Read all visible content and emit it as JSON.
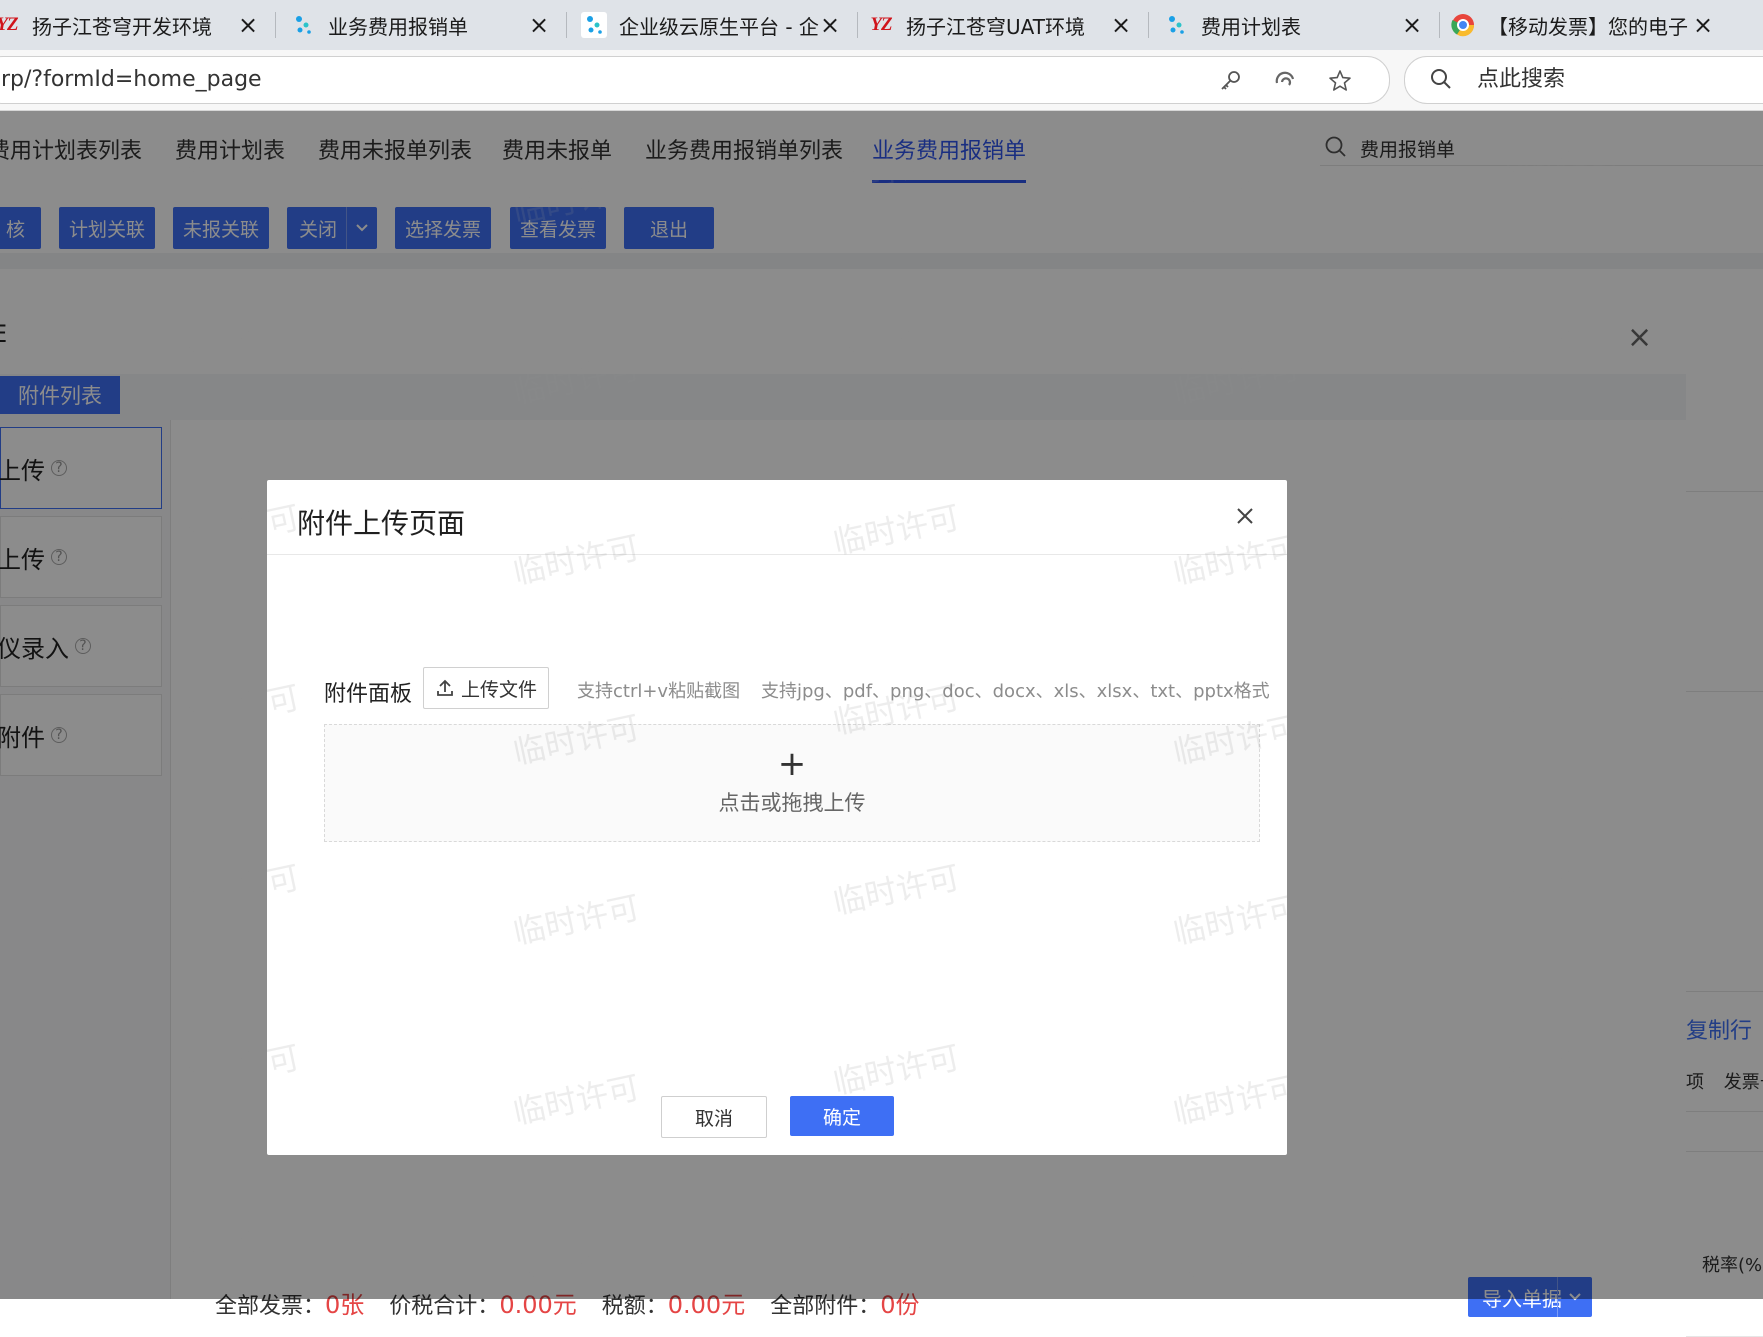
{
  "browser": {
    "tabs": [
      {
        "label": "扬子江苍穹开发环境",
        "icon": "yz-logo-icon"
      },
      {
        "label": "业务费用报销单",
        "icon": "cloud-dots-icon"
      },
      {
        "label": "企业级云原生平台 - 企业",
        "icon": "cloud-dots-icon"
      },
      {
        "label": "扬子江苍穹UAT环境",
        "icon": "yz-logo-icon"
      },
      {
        "label": "费用计划表",
        "icon": "cloud-dots-icon"
      },
      {
        "label": "【移动发票】您的电子发",
        "icon": "chrome-like-icon"
      }
    ],
    "url": "rp/?formId=home_page",
    "search_placeholder": "点此搜索"
  },
  "app": {
    "nav_tabs": [
      "费用计划表列表",
      "费用计划表",
      "费用未报单列表",
      "费用未报单",
      "业务费用报销单列表",
      "业务费用报销单"
    ],
    "active_tab": "业务费用报销单",
    "search_text": "费用报销单",
    "toolbar": [
      "核",
      "计划关联",
      "未报关联",
      "关闭",
      "选择发票",
      "查看发票",
      "退出"
    ],
    "right_panel": {
      "copy_row": "复制行",
      "invoice_no": "发票号",
      "invoice_prefix": "项",
      "tax_rate": "税率(%)"
    }
  },
  "attach_window": {
    "title": "E",
    "tab": "附件列表",
    "side_items": [
      "上传",
      "上传",
      "仪录入",
      "附件"
    ],
    "summary": {
      "all_invoice_label": "全部发票：",
      "all_invoice_value": "0张",
      "total_label": "价税合计：",
      "total_value": "0.00元",
      "tax_label": "税额：",
      "tax_value": "0.00元",
      "attach_label": "全部附件：",
      "attach_value": "0份"
    },
    "import_button": "导入单据"
  },
  "upload_modal": {
    "title": "附件上传页面",
    "panel_label": "附件面板",
    "upload_button": "上传文件",
    "hint_paste": "支持ctrl+v粘贴截图",
    "hint_formats": "支持jpg、pdf、png、doc、docx、xls、xlsx、txt、pptx格式",
    "dropzone_plus": "+",
    "dropzone_text": "点击或拖拽上传",
    "cancel": "取消",
    "confirm": "确定"
  },
  "watermark": "临时许可",
  "colors": {
    "accent": "#3e6ff4",
    "danger": "#e54545",
    "brand_red": "#d0141b"
  }
}
